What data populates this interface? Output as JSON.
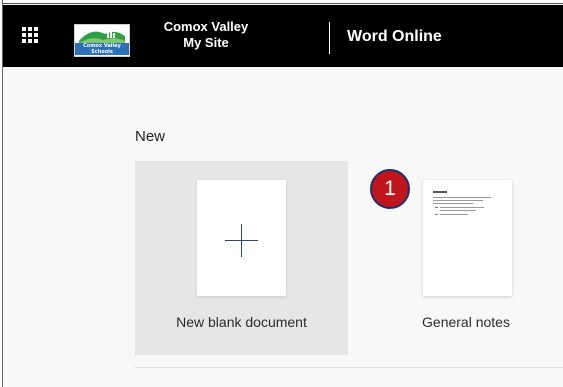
{
  "header": {
    "site_title_line1": "Comox Valley",
    "site_title_line2": "My Site",
    "app_name": "Word Online",
    "logo_text": "Comox Valley Schools"
  },
  "main": {
    "section_title": "New",
    "new_blank_label": "New blank document",
    "template_label": "General notes"
  },
  "annotation": {
    "badge_number": "1"
  },
  "colors": {
    "header_bg": "#000000",
    "badge_fill": "#c0151b",
    "badge_border": "#1e2f6e",
    "card_bg": "#e6e6e6"
  }
}
